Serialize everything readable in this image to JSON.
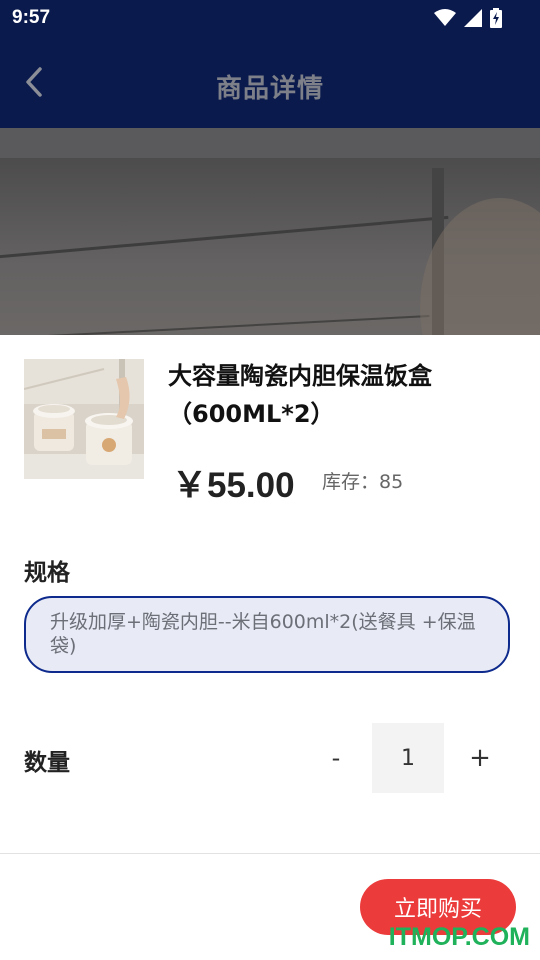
{
  "status_bar": {
    "time": "9:57",
    "icons": [
      "wifi-icon",
      "cell-signal-icon",
      "battery-charging-icon"
    ]
  },
  "nav": {
    "back_icon": "chevron-left-icon",
    "title": "商品详情"
  },
  "product": {
    "name": "大容量陶瓷内胆保温饭盒（600ML*2）",
    "price": "￥55.00",
    "stock_label": "库存：85"
  },
  "spec": {
    "label": "规格",
    "selected_option": "升级加厚+陶瓷内胆--米自600ml*2(送餐具 +保温袋)"
  },
  "quantity": {
    "label": "数量",
    "minus": "-",
    "value": "1",
    "plus": "+"
  },
  "actions": {
    "buy_now": "立即购买"
  },
  "watermark": "ITMOP.COM",
  "colors": {
    "nav_bg": "#0b1a4d",
    "accent_border": "#0d2a8c",
    "chip_bg": "#e8ebf5",
    "buy_btn": "#ec3b3b",
    "watermark": "#1fb25a"
  }
}
